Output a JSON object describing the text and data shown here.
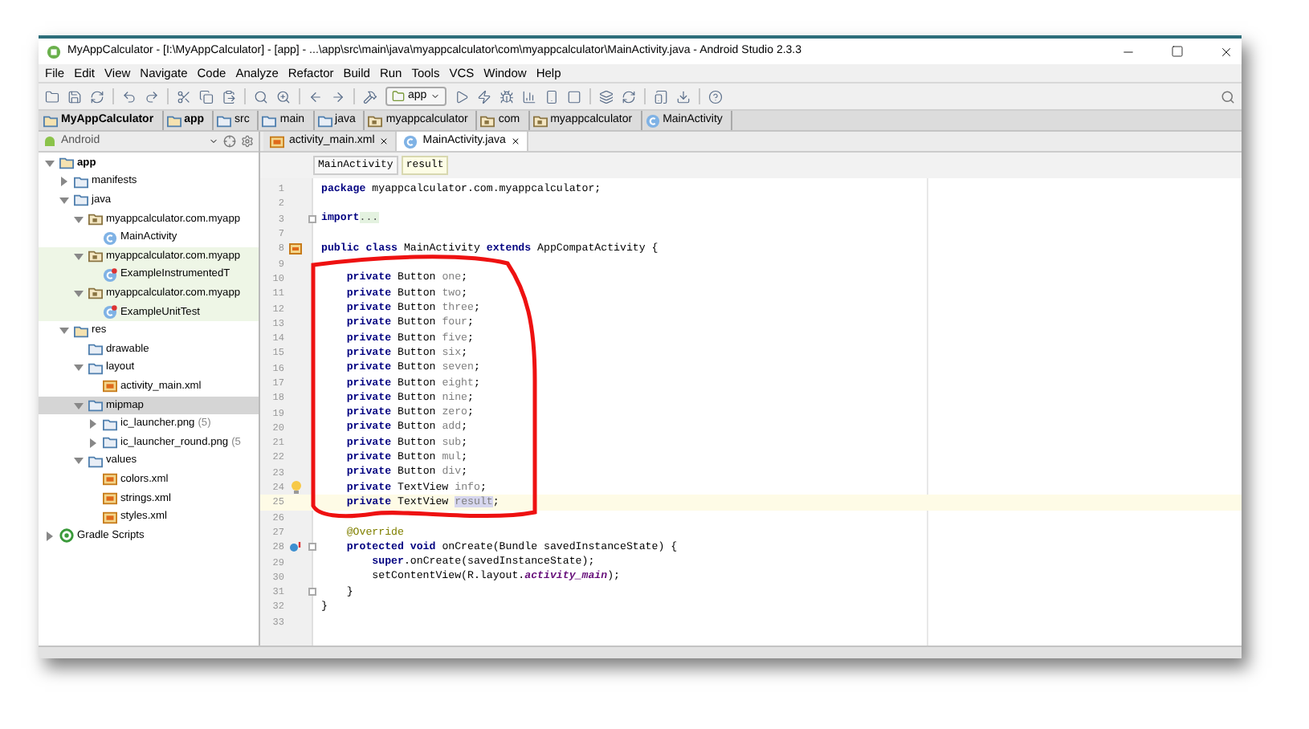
{
  "window": {
    "title": "MyAppCalculator - [I:\\MyAppCalculator] - [app] - ...\\app\\src\\main\\java\\myappcalculator\\com\\myappcalculator\\MainActivity.java - Android Studio 2.3.3"
  },
  "menu": [
    "File",
    "Edit",
    "View",
    "Navigate",
    "Code",
    "Analyze",
    "Refactor",
    "Build",
    "Run",
    "Tools",
    "VCS",
    "Window",
    "Help"
  ],
  "toolbar": {
    "config": "app"
  },
  "breadcrumbs": [
    {
      "label": "MyAppCalculator",
      "kind": "project"
    },
    {
      "label": "app",
      "kind": "module"
    },
    {
      "label": "src",
      "kind": "folder"
    },
    {
      "label": "main",
      "kind": "folder"
    },
    {
      "label": "java",
      "kind": "folder"
    },
    {
      "label": "myappcalculator",
      "kind": "package"
    },
    {
      "label": "com",
      "kind": "package"
    },
    {
      "label": "myappcalculator",
      "kind": "package"
    },
    {
      "label": "MainActivity",
      "kind": "class"
    }
  ],
  "project_panel": {
    "view": "Android",
    "tree": [
      {
        "label": "app",
        "kind": "module",
        "expanded": true,
        "selected": false,
        "test": false,
        "children": [
          {
            "label": "manifests",
            "kind": "folder",
            "expanded": false,
            "selected": false,
            "test": false
          },
          {
            "label": "java",
            "kind": "folder",
            "expanded": true,
            "selected": false,
            "test": false,
            "children": [
              {
                "label": "myappcalculator.com.myapp",
                "kind": "package",
                "expanded": true,
                "selected": false,
                "test": false,
                "children": [
                  {
                    "label": "MainActivity",
                    "kind": "class",
                    "selected": false,
                    "test": false
                  }
                ]
              },
              {
                "label": "myappcalculator.com.myapp",
                "kind": "package",
                "expanded": true,
                "selected": false,
                "test": true,
                "children": [
                  {
                    "label": "ExampleInstrumentedT",
                    "kind": "testclass",
                    "selected": false,
                    "test": true
                  }
                ]
              },
              {
                "label": "myappcalculator.com.myapp",
                "kind": "package",
                "expanded": true,
                "selected": false,
                "test": true,
                "children": [
                  {
                    "label": "ExampleUnitTest",
                    "kind": "testclass",
                    "selected": false,
                    "test": true
                  }
                ]
              }
            ]
          },
          {
            "label": "res",
            "kind": "resfolder",
            "expanded": true,
            "selected": false,
            "test": false,
            "children": [
              {
                "label": "drawable",
                "kind": "folder",
                "selected": false,
                "test": false
              },
              {
                "label": "layout",
                "kind": "folder",
                "expanded": true,
                "selected": false,
                "test": false,
                "children": [
                  {
                    "label": "activity_main.xml",
                    "kind": "xml",
                    "selected": false,
                    "test": false
                  }
                ]
              },
              {
                "label": "mipmap",
                "kind": "folder",
                "expanded": true,
                "selected": true,
                "test": false,
                "children": [
                  {
                    "label": "ic_launcher.png",
                    "count": "(5)",
                    "kind": "folder",
                    "expanded": false,
                    "selected": false,
                    "test": false
                  },
                  {
                    "label": "ic_launcher_round.png",
                    "count": "(5",
                    "kind": "folder",
                    "expanded": false,
                    "selected": false,
                    "test": false
                  }
                ]
              },
              {
                "label": "values",
                "kind": "folder",
                "expanded": true,
                "selected": false,
                "test": false,
                "children": [
                  {
                    "label": "colors.xml",
                    "kind": "xml",
                    "selected": false,
                    "test": false
                  },
                  {
                    "label": "strings.xml",
                    "kind": "xml",
                    "selected": false,
                    "test": false
                  },
                  {
                    "label": "styles.xml",
                    "kind": "xml",
                    "selected": false,
                    "test": false
                  }
                ]
              }
            ]
          }
        ]
      },
      {
        "label": "Gradle Scripts",
        "kind": "gradle",
        "expanded": false,
        "selected": false,
        "test": false
      }
    ]
  },
  "tabs": [
    {
      "label": "activity_main.xml",
      "kind": "xml",
      "selected": false
    },
    {
      "label": "MainActivity.java",
      "kind": "class",
      "selected": true
    }
  ],
  "structure": [
    {
      "label": "MainActivity",
      "selected": false
    },
    {
      "label": "result",
      "selected": true
    }
  ],
  "code": [
    {
      "number": "1",
      "kind": "plain",
      "current": false,
      "segments": [
        {
          "kind": "keyword",
          "text": "package"
        },
        {
          "kind": "plain",
          "text": " myappcalculator.com.myappcalculator;"
        }
      ]
    },
    {
      "number": "2",
      "kind": "plain",
      "current": false
    },
    {
      "number": "3",
      "kind": "plain",
      "current": false,
      "fold": true,
      "segments": [
        {
          "kind": "keyword",
          "text": "import"
        },
        {
          "kind": "folded",
          "text": "..."
        }
      ]
    },
    {
      "number": "7",
      "kind": "plain",
      "current": false
    },
    {
      "number": "8",
      "kind": "class_marker",
      "current": false,
      "segments": [
        {
          "kind": "keyword",
          "text": "public class"
        },
        {
          "kind": "plain",
          "text": " MainActivity "
        },
        {
          "kind": "keyword",
          "text": "extends"
        },
        {
          "kind": "plain",
          "text": " AppCompatActivity {"
        }
      ]
    },
    {
      "number": "9",
      "kind": "plain",
      "current": false
    },
    {
      "number": "10",
      "kind": "plain",
      "current": false,
      "segments": [
        {
          "kind": "keyword",
          "text": "    private"
        },
        {
          "kind": "plain",
          "text": " Button "
        },
        {
          "kind": "unused",
          "text": "one"
        },
        {
          "kind": "plain",
          "text": ";"
        }
      ]
    },
    {
      "number": "11",
      "kind": "plain",
      "current": false,
      "segments": [
        {
          "kind": "keyword",
          "text": "    private"
        },
        {
          "kind": "plain",
          "text": " Button "
        },
        {
          "kind": "unused",
          "text": "two"
        },
        {
          "kind": "plain",
          "text": ";"
        }
      ]
    },
    {
      "number": "12",
      "kind": "plain",
      "current": false,
      "segments": [
        {
          "kind": "keyword",
          "text": "    private"
        },
        {
          "kind": "plain",
          "text": " Button "
        },
        {
          "kind": "unused",
          "text": "three"
        },
        {
          "kind": "plain",
          "text": ";"
        }
      ]
    },
    {
      "number": "13",
      "kind": "plain",
      "current": false,
      "segments": [
        {
          "kind": "keyword",
          "text": "    private"
        },
        {
          "kind": "plain",
          "text": " Button "
        },
        {
          "kind": "unused",
          "text": "four"
        },
        {
          "kind": "plain",
          "text": ";"
        }
      ]
    },
    {
      "number": "14",
      "kind": "plain",
      "current": false,
      "segments": [
        {
          "kind": "keyword",
          "text": "    private"
        },
        {
          "kind": "plain",
          "text": " Button "
        },
        {
          "kind": "unused",
          "text": "five"
        },
        {
          "kind": "plain",
          "text": ";"
        }
      ]
    },
    {
      "number": "15",
      "kind": "plain",
      "current": false,
      "segments": [
        {
          "kind": "keyword",
          "text": "    private"
        },
        {
          "kind": "plain",
          "text": " Button "
        },
        {
          "kind": "unused",
          "text": "six"
        },
        {
          "kind": "plain",
          "text": ";"
        }
      ]
    },
    {
      "number": "16",
      "kind": "plain",
      "current": false,
      "segments": [
        {
          "kind": "keyword",
          "text": "    private"
        },
        {
          "kind": "plain",
          "text": " Button "
        },
        {
          "kind": "unused",
          "text": "seven"
        },
        {
          "kind": "plain",
          "text": ";"
        }
      ]
    },
    {
      "number": "17",
      "kind": "plain",
      "current": false,
      "segments": [
        {
          "kind": "keyword",
          "text": "    private"
        },
        {
          "kind": "plain",
          "text": " Button "
        },
        {
          "kind": "unused",
          "text": "eight"
        },
        {
          "kind": "plain",
          "text": ";"
        }
      ]
    },
    {
      "number": "18",
      "kind": "plain",
      "current": false,
      "segments": [
        {
          "kind": "keyword",
          "text": "    private"
        },
        {
          "kind": "plain",
          "text": " Button "
        },
        {
          "kind": "unused",
          "text": "nine"
        },
        {
          "kind": "plain",
          "text": ";"
        }
      ]
    },
    {
      "number": "19",
      "kind": "plain",
      "current": false,
      "segments": [
        {
          "kind": "keyword",
          "text": "    private"
        },
        {
          "kind": "plain",
          "text": " Button "
        },
        {
          "kind": "unused",
          "text": "zero"
        },
        {
          "kind": "plain",
          "text": ";"
        }
      ]
    },
    {
      "number": "20",
      "kind": "plain",
      "current": false,
      "segments": [
        {
          "kind": "keyword",
          "text": "    private"
        },
        {
          "kind": "plain",
          "text": " Button "
        },
        {
          "kind": "unused",
          "text": "add"
        },
        {
          "kind": "plain",
          "text": ";"
        }
      ]
    },
    {
      "number": "21",
      "kind": "plain",
      "current": false,
      "segments": [
        {
          "kind": "keyword",
          "text": "    private"
        },
        {
          "kind": "plain",
          "text": " Button "
        },
        {
          "kind": "unused",
          "text": "sub"
        },
        {
          "kind": "plain",
          "text": ";"
        }
      ]
    },
    {
      "number": "22",
      "kind": "plain",
      "current": false,
      "segments": [
        {
          "kind": "keyword",
          "text": "    private"
        },
        {
          "kind": "plain",
          "text": " Button "
        },
        {
          "kind": "unused",
          "text": "mul"
        },
        {
          "kind": "plain",
          "text": ";"
        }
      ]
    },
    {
      "number": "23",
      "kind": "plain",
      "current": false,
      "segments": [
        {
          "kind": "keyword",
          "text": "    private"
        },
        {
          "kind": "plain",
          "text": " Button "
        },
        {
          "kind": "unused",
          "text": "div"
        },
        {
          "kind": "plain",
          "text": ";"
        }
      ]
    },
    {
      "number": "24",
      "kind": "bulb",
      "current": false,
      "segments": [
        {
          "kind": "keyword",
          "text": "    private"
        },
        {
          "kind": "plain",
          "text": " TextView "
        },
        {
          "kind": "unused",
          "text": "info"
        },
        {
          "kind": "plain",
          "text": ";"
        }
      ]
    },
    {
      "number": "25",
      "kind": "plain",
      "current": true,
      "segments": [
        {
          "kind": "keyword",
          "text": "    private"
        },
        {
          "kind": "plain",
          "text": " TextView "
        },
        {
          "kind": "selection",
          "text": "result"
        },
        {
          "kind": "plain",
          "text": ";"
        }
      ]
    },
    {
      "number": "26",
      "kind": "plain",
      "current": false
    },
    {
      "number": "27",
      "kind": "plain",
      "current": false,
      "segments": [
        {
          "kind": "annotation",
          "text": "    @Override"
        }
      ]
    },
    {
      "number": "28",
      "kind": "override",
      "current": false,
      "fold": true,
      "segments": [
        {
          "kind": "keyword",
          "text": "    protected void"
        },
        {
          "kind": "plain",
          "text": " onCreate(Bundle savedInstanceState) {"
        }
      ]
    },
    {
      "number": "29",
      "kind": "plain",
      "current": false,
      "segments": [
        {
          "kind": "keyword",
          "text": "        super"
        },
        {
          "kind": "plain",
          "text": ".onCreate(savedInstanceState);"
        }
      ]
    },
    {
      "number": "30",
      "kind": "plain",
      "current": false,
      "segments": [
        {
          "kind": "plain",
          "text": "        setContentView(R.layout."
        },
        {
          "kind": "static",
          "text": "activity_main"
        },
        {
          "kind": "plain",
          "text": ");"
        }
      ]
    },
    {
      "number": "31",
      "kind": "plain",
      "current": false,
      "fold": true,
      "segments": [
        {
          "kind": "plain",
          "text": "    }"
        }
      ]
    },
    {
      "number": "32",
      "kind": "plain",
      "current": false,
      "segments": [
        {
          "kind": "plain",
          "text": "}"
        }
      ]
    },
    {
      "number": "33",
      "kind": "plain",
      "current": false
    }
  ]
}
